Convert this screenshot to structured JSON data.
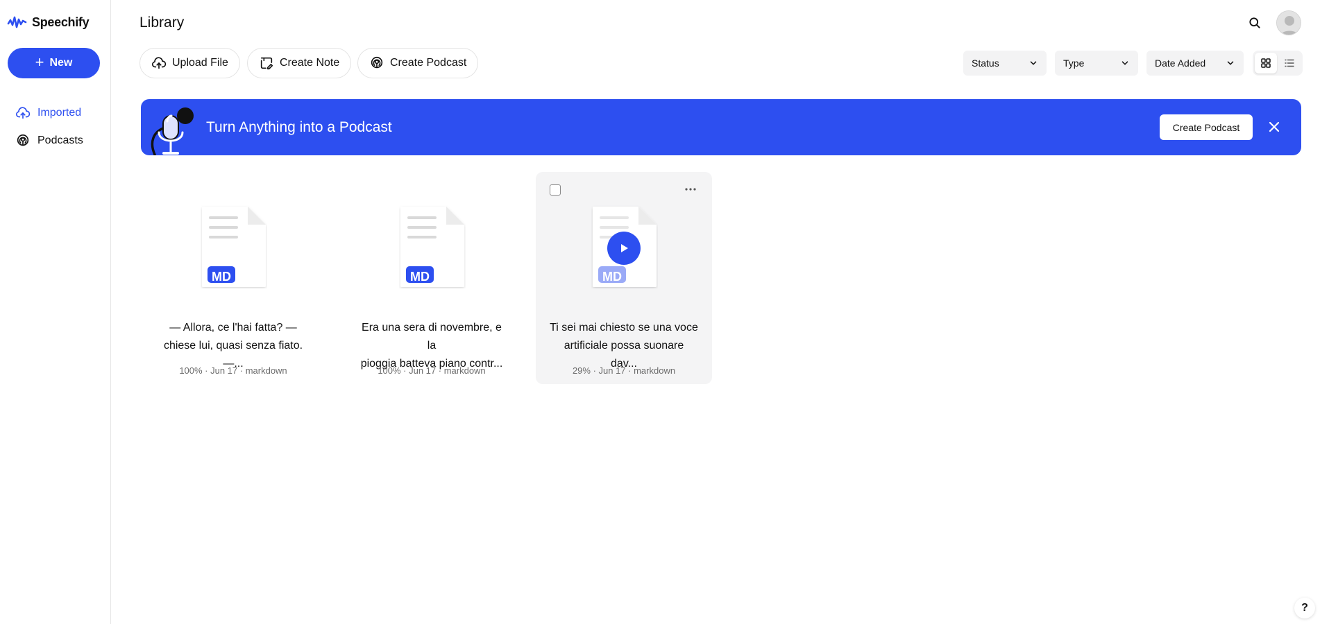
{
  "app": {
    "name": "Speechify",
    "accent": "#2d4ff0"
  },
  "sidebar": {
    "new_label": "New",
    "items": [
      {
        "label": "Imported",
        "icon": "upload-cloud-icon",
        "active": true
      },
      {
        "label": "Podcasts",
        "icon": "podcast-icon",
        "active": false
      }
    ]
  },
  "header": {
    "title": "Library"
  },
  "toolbar": {
    "upload_label": "Upload File",
    "create_note_label": "Create Note",
    "create_podcast_label": "Create Podcast",
    "filters": [
      {
        "label": "Status"
      },
      {
        "label": "Type"
      },
      {
        "label": "Date Added"
      }
    ],
    "view_mode": "grid"
  },
  "banner": {
    "text": "Turn Anything into a Podcast",
    "cta_label": "Create Podcast"
  },
  "documents": [
    {
      "title_line1": "— Allora, ce l'hai fatta? —",
      "title_line2": "chiese lui, quasi senza fiato. —...",
      "meta": "100% · Jun 17 · markdown",
      "badge": "MD"
    },
    {
      "title_line1": "Era una sera di novembre, e la",
      "title_line2": "pioggia batteva piano contr...",
      "meta": "100% · Jun 17 · markdown",
      "badge": "MD"
    },
    {
      "title_line1": "Ti sei mai chiesto se una voce",
      "title_line2": "artificiale possa suonare dav...",
      "meta": "29% · Jun 17 · markdown",
      "badge": "MD"
    }
  ],
  "help": {
    "label": "?"
  }
}
